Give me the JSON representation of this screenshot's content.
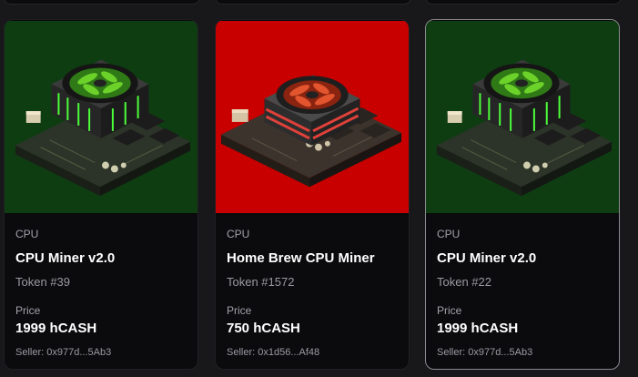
{
  "colors": {
    "page_bg": "#18181b",
    "card_bg": "#0b0b0d",
    "green_thumb": "#0f3d12",
    "red_thumb": "#c80000",
    "selected_border": "#8a8a8f"
  },
  "labels": {
    "price_label": "Price"
  },
  "cards": [
    {
      "category": "CPU",
      "name": "CPU Miner v2.0",
      "token": "Token #39",
      "price": "1999 hCASH",
      "seller": "Seller: 0x977d...5Ab3",
      "image": "cpu-miner-green-icon",
      "thumb_color": "#0f3d12"
    },
    {
      "category": "CPU",
      "name": "Home Brew CPU Miner",
      "token": "Token #1572",
      "price": "750 hCASH",
      "seller": "Seller: 0x1d56...Af48",
      "image": "cpu-miner-red-icon",
      "thumb_color": "#c80000"
    },
    {
      "category": "CPU",
      "name": "CPU Miner v2.0",
      "token": "Token #22",
      "price": "1999 hCASH",
      "seller": "Seller: 0x977d...5Ab3",
      "image": "cpu-miner-green-icon",
      "thumb_color": "#0f3d12"
    }
  ]
}
